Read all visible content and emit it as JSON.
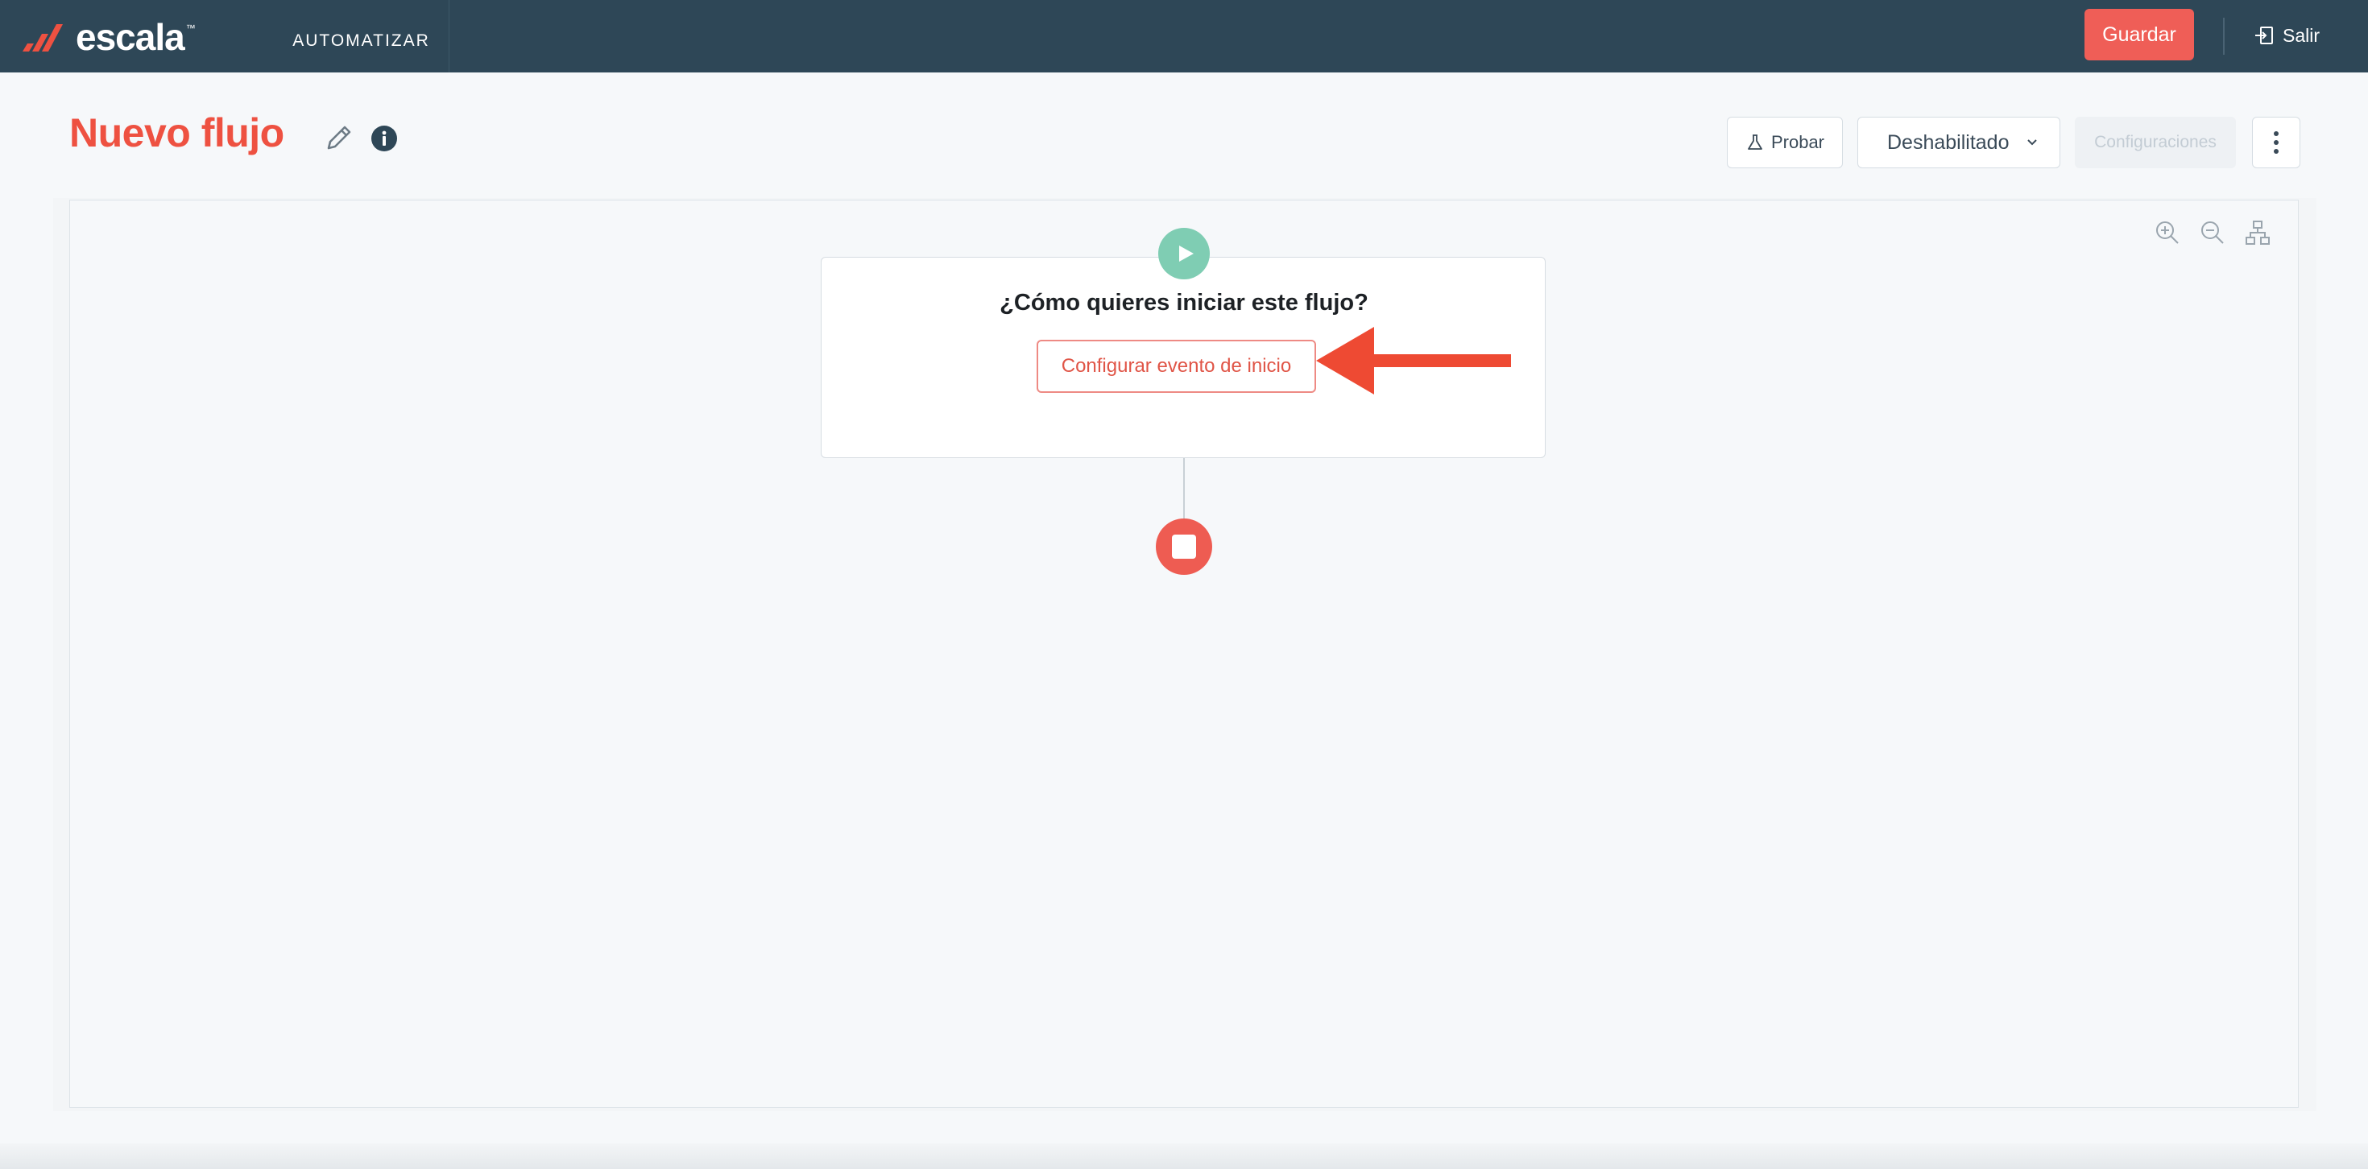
{
  "topbar": {
    "brand": "escala",
    "brand_tm": "™",
    "nav_item": "AUTOMATIZAR",
    "save_label": "Guardar",
    "logout_label": "Salir",
    "accent_color": "#ef5e57",
    "bar_color": "#2e4757"
  },
  "header": {
    "title": "Nuevo flujo",
    "test_label": "Probar",
    "status_select": {
      "selected": "Deshabilitado"
    },
    "settings_label": "Configuraciones"
  },
  "canvas": {
    "zoom_icons": [
      "zoom-in-icon",
      "zoom-out-icon",
      "layout-tree-icon"
    ],
    "start_card": {
      "question": "¿Cómo quieres iniciar este flujo?",
      "configure_label": "Configurar evento de inicio"
    },
    "start_node_color": "#7fcdb3",
    "end_node_color": "#ee5c52"
  },
  "annotation": {
    "arrow_color": "#ee4a33"
  }
}
